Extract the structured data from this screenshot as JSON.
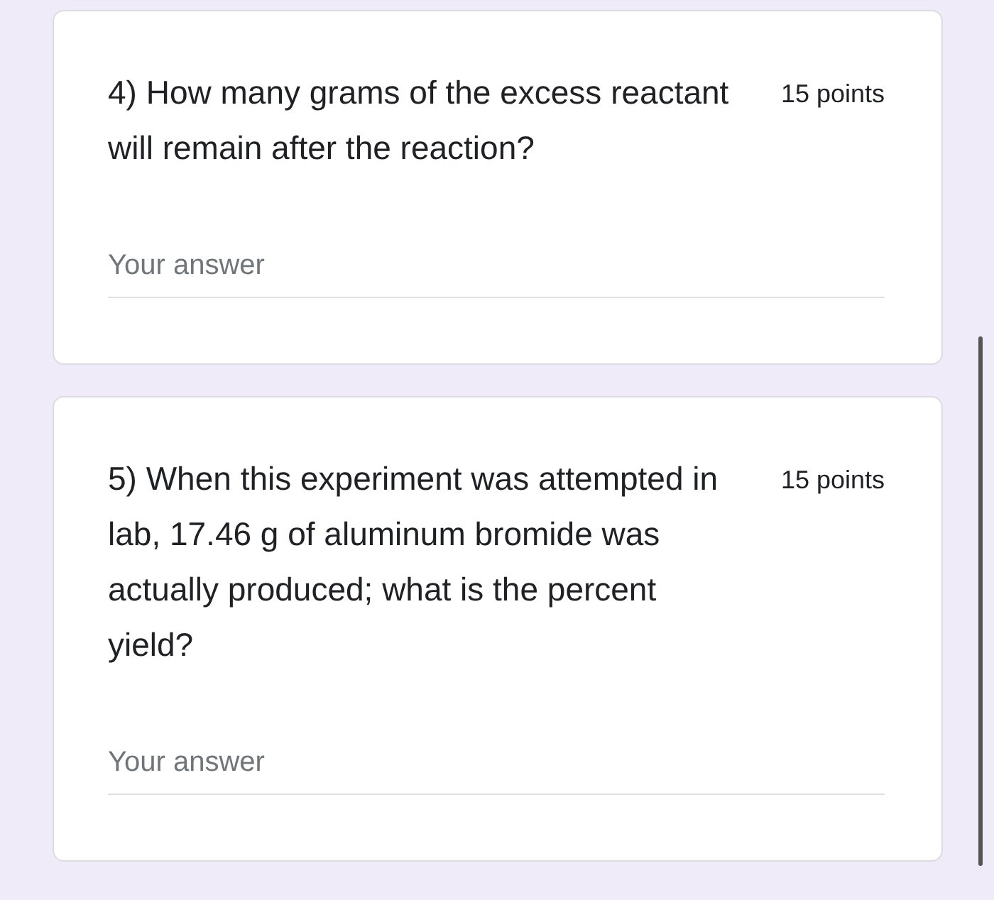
{
  "questions": [
    {
      "title": "4) How many grams of the excess reactant will remain after the reaction?",
      "points": "15 points",
      "placeholder": "Your answer"
    },
    {
      "title": "5) When this experiment was attempted in lab, 17.46 g of aluminum bromide was actually produced; what is the percent yield?",
      "points": "15 points",
      "placeholder": "Your answer"
    }
  ]
}
